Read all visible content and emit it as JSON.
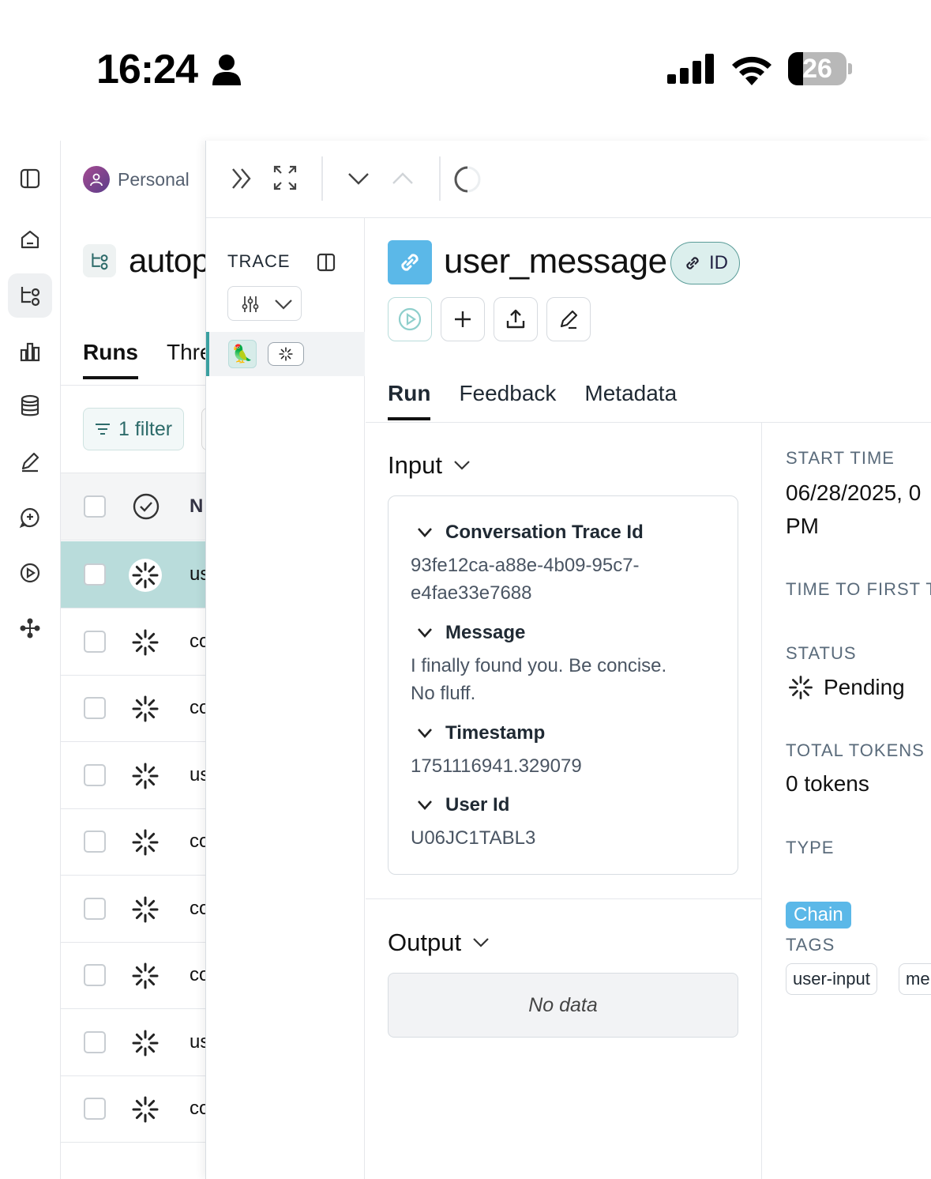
{
  "status_bar": {
    "time": "16:24",
    "battery_level": "26",
    "battery_fraction": 0.26
  },
  "sidebar": {
    "items": [
      {
        "name": "panel-toggle-icon"
      },
      {
        "name": "home-icon"
      },
      {
        "name": "tracing-projects-icon",
        "active": true
      },
      {
        "name": "monitoring-icon"
      },
      {
        "name": "datasets-icon"
      },
      {
        "name": "annotation-icon"
      },
      {
        "name": "prompts-icon"
      },
      {
        "name": "playground-icon"
      },
      {
        "name": "deployments-icon"
      }
    ]
  },
  "runs_panel": {
    "workspace": "Personal",
    "project_title": "autop",
    "tabs": [
      "Runs",
      "Thre"
    ],
    "filter_label": "1 filter",
    "column_name_header": "N",
    "rows": [
      {
        "name": "us",
        "selected": true
      },
      {
        "name": "co"
      },
      {
        "name": "co"
      },
      {
        "name": "us"
      },
      {
        "name": "co"
      },
      {
        "name": "co"
      },
      {
        "name": "co"
      },
      {
        "name": "us"
      },
      {
        "name": "co"
      }
    ]
  },
  "trace": {
    "label": "TRACE",
    "node_emoji": "🦜"
  },
  "run_detail": {
    "title": "user_message",
    "id_badge": "ID",
    "tabs": [
      "Run",
      "Feedback",
      "Metadata"
    ],
    "active_tab": "Run",
    "input": {
      "heading": "Input",
      "fields": [
        {
          "key": "Conversation Trace Id",
          "value_lines": [
            "93fe12ca-a88e-4b09-95c7-",
            "e4fae33e7688"
          ]
        },
        {
          "key": "Message",
          "value_lines": [
            "I finally found you. Be concise.",
            "No fluff."
          ]
        },
        {
          "key": "Timestamp",
          "value_lines": [
            "1751116941.329079"
          ]
        },
        {
          "key": "User Id",
          "value_lines": [
            "U06JC1TABL3"
          ]
        }
      ]
    },
    "output": {
      "heading": "Output",
      "empty_text": "No data"
    },
    "meta": {
      "start_time_label": "START TIME",
      "start_time_line1": "06/28/2025, 0",
      "start_time_line2": "PM",
      "ttft_label": "TIME TO FIRST T",
      "status_label": "STATUS",
      "status_value": "Pending",
      "tokens_label": "TOTAL TOKENS",
      "tokens_value": "0 tokens",
      "type_label": "TYPE",
      "type_value": "Chain",
      "tags_label": "TAGS",
      "tags": [
        "user-input",
        "me"
      ]
    }
  },
  "colors": {
    "accent_teal": "#2d6b6a",
    "selected_row": "#b9dcdb",
    "chain_blue": "#5bb8e8"
  }
}
